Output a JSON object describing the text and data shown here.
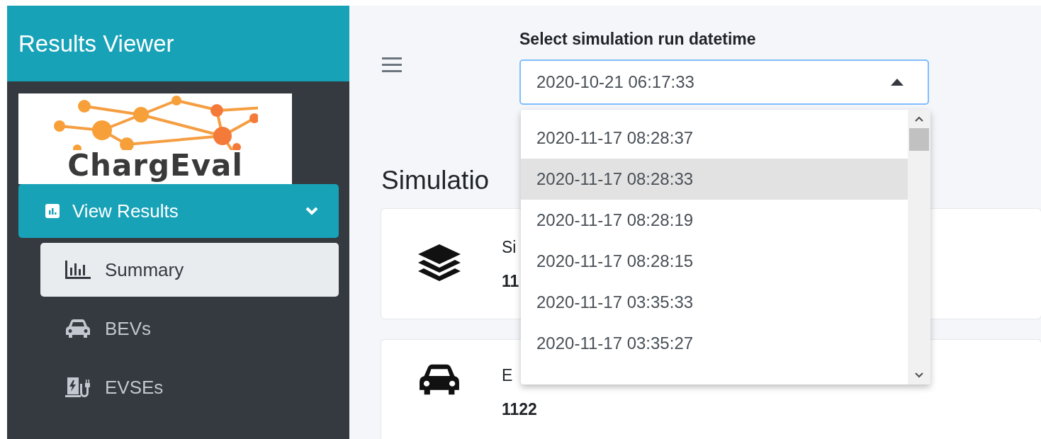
{
  "sidebar": {
    "title": "Results Viewer",
    "logo_text": "ChargEval",
    "menu": [
      {
        "label": "View Results",
        "selected": true,
        "expanded": true,
        "children": [
          {
            "label": "Summary",
            "selected": true
          },
          {
            "label": "BEVs",
            "selected": false
          },
          {
            "label": "EVSEs",
            "selected": false
          }
        ]
      }
    ]
  },
  "run_select": {
    "label": "Select simulation run datetime",
    "value": "2020-10-21 06:17:33",
    "expanded": true,
    "options": [
      {
        "label": "2020-11-17 08:28:37",
        "selected": false
      },
      {
        "label": "2020-11-17 08:28:33",
        "selected": true
      },
      {
        "label": "2020-11-17 08:28:19",
        "selected": false
      },
      {
        "label": "2020-11-17 08:28:15",
        "selected": false
      },
      {
        "label": "2020-11-17 03:35:33",
        "selected": false
      },
      {
        "label": "2020-11-17 03:35:27",
        "selected": false
      }
    ]
  },
  "heading": "Simulatio",
  "cards": [
    {
      "label": "Si",
      "value": "11"
    },
    {
      "label": "E",
      "value": "1122"
    }
  ]
}
